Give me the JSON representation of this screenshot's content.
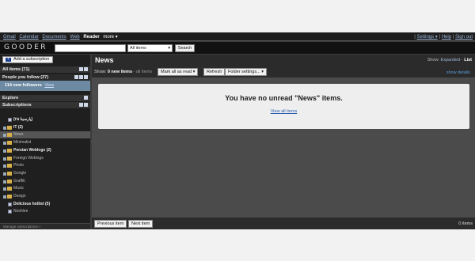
{
  "topbar": {
    "links": [
      "Gmail",
      "Calendar",
      "Documents",
      "Web"
    ],
    "active": "Reader",
    "more": "more ▾",
    "settings": "Settings ▾",
    "help": "Help",
    "signout": "Sign out"
  },
  "header": {
    "logo": "GOODER",
    "search_value": "",
    "scope": "All items",
    "search_button": "Search"
  },
  "sidebar": {
    "add_subscription": "Add a subscription",
    "all_items": "All items (71)",
    "people": "People you follow (27)",
    "followers": "114 new followers",
    "followers_view": "View",
    "explore": "Explore",
    "subscriptions": "Subscriptions",
    "items": [
      {
        "label": "(۲۵ پارسینا)",
        "bold": true,
        "kind": "feed"
      },
      {
        "label": "IT (2)",
        "bold": true,
        "kind": "folder"
      },
      {
        "label": "News",
        "bold": false,
        "kind": "folder"
      },
      {
        "label": "Minimalist",
        "bold": false,
        "kind": "folder"
      },
      {
        "label": "Persian Weblogs (2)",
        "bold": true,
        "kind": "folder"
      },
      {
        "label": "Foreign Weblogs",
        "bold": false,
        "kind": "folder"
      },
      {
        "label": "Photo",
        "bold": false,
        "kind": "folder"
      },
      {
        "label": "Google",
        "bold": false,
        "kind": "folder"
      },
      {
        "label": "Graffiti",
        "bold": false,
        "kind": "folder"
      },
      {
        "label": "Music",
        "bold": false,
        "kind": "folder"
      },
      {
        "label": "Design",
        "bold": false,
        "kind": "folder"
      },
      {
        "label": "Delicious hotlist (5)",
        "bold": true,
        "kind": "feed"
      },
      {
        "label": "Noshlee",
        "bold": false,
        "kind": "feed"
      }
    ],
    "manage": "Manage subscriptions »"
  },
  "main": {
    "title": "News",
    "show_label": "Show:",
    "expanded": "Expanded",
    "separator": "-",
    "list": "List",
    "status_prefix": "Show:",
    "new_items": "0 new items",
    "all_items": "- all items",
    "mark_all": "Mark all as read",
    "refresh": "Refresh",
    "folder_settings": "Folder settings...",
    "show_details": "show details",
    "message": "You have no unread \"News\" items.",
    "view_all": "View all items",
    "previous": "Previous item",
    "next": "Next item",
    "count": "0 items"
  }
}
